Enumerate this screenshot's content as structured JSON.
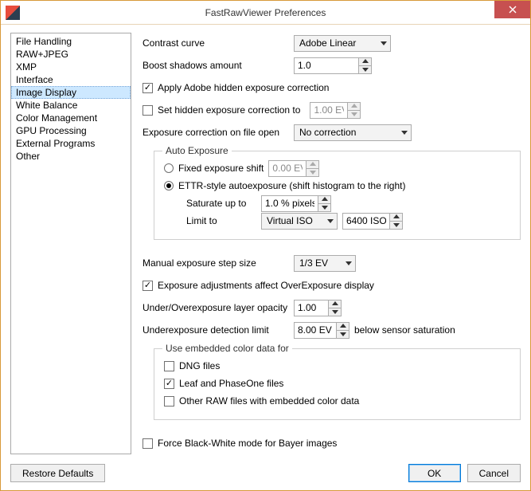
{
  "window": {
    "title": "FastRawViewer Preferences"
  },
  "sidebar": {
    "items": [
      {
        "label": "File Handling"
      },
      {
        "label": "RAW+JPEG"
      },
      {
        "label": "XMP"
      },
      {
        "label": "Interface"
      },
      {
        "label": "Image Display",
        "selected": true
      },
      {
        "label": "White Balance"
      },
      {
        "label": "Color Management"
      },
      {
        "label": "GPU Processing"
      },
      {
        "label": "External Programs"
      },
      {
        "label": "Other"
      }
    ]
  },
  "settings": {
    "contrast_curve": {
      "label": "Contrast curve",
      "value": "Adobe Linear"
    },
    "boost_shadows": {
      "label": "Boost shadows amount",
      "value": "1.0"
    },
    "apply_adobe_hidden": {
      "label": "Apply Adobe hidden exposure correction",
      "checked": true
    },
    "set_hidden_to": {
      "label": "Set hidden exposure correction to",
      "checked": false,
      "value": "1.00 EV"
    },
    "exposure_on_open": {
      "label": "Exposure correction on file open",
      "value": "No correction"
    },
    "auto_exposure": {
      "legend": "Auto Exposure",
      "fixed": {
        "label": "Fixed exposure shift",
        "selected": false,
        "value": "0.00 EV"
      },
      "ettr": {
        "label": "ETTR-style autoexposure (shift histogram to the right)",
        "selected": true
      },
      "saturate": {
        "label": "Saturate up to",
        "value": "1.0 % pixels"
      },
      "limit_to": {
        "label": "Limit to",
        "kind": "Virtual ISO",
        "value": "6400 ISO"
      }
    },
    "manual_step": {
      "label": "Manual exposure step size",
      "value": "1/3 EV"
    },
    "exposure_affects_over": {
      "label": "Exposure adjustments affect OverExposure display",
      "checked": true
    },
    "layer_opacity": {
      "label": "Under/Overexposure layer opacity",
      "value": "1.00"
    },
    "underexposure_limit": {
      "label": "Underexposure detection limit",
      "value": "8.00 EV",
      "suffix": "below sensor saturation"
    },
    "embedded_color": {
      "legend": "Use embedded color data for",
      "dng": {
        "label": "DNG files",
        "checked": false
      },
      "leaf": {
        "label": "Leaf and PhaseOne files",
        "checked": true
      },
      "other": {
        "label": "Other RAW files with embedded color data",
        "checked": false
      }
    },
    "force_bw": {
      "label": "Force Black-White mode for Bayer images",
      "checked": false
    }
  },
  "footer": {
    "restore": "Restore Defaults",
    "ok": "OK",
    "cancel": "Cancel"
  }
}
